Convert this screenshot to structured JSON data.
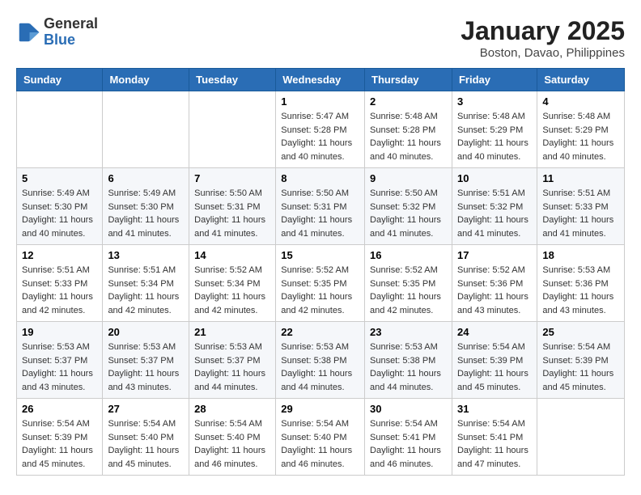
{
  "header": {
    "logo_line1": "General",
    "logo_line2": "Blue",
    "title": "January 2025",
    "subtitle": "Boston, Davao, Philippines"
  },
  "calendar": {
    "days_of_week": [
      "Sunday",
      "Monday",
      "Tuesday",
      "Wednesday",
      "Thursday",
      "Friday",
      "Saturday"
    ],
    "weeks": [
      [
        {
          "day": "",
          "info": ""
        },
        {
          "day": "",
          "info": ""
        },
        {
          "day": "",
          "info": ""
        },
        {
          "day": "1",
          "info": "Sunrise: 5:47 AM\nSunset: 5:28 PM\nDaylight: 11 hours\nand 40 minutes."
        },
        {
          "day": "2",
          "info": "Sunrise: 5:48 AM\nSunset: 5:28 PM\nDaylight: 11 hours\nand 40 minutes."
        },
        {
          "day": "3",
          "info": "Sunrise: 5:48 AM\nSunset: 5:29 PM\nDaylight: 11 hours\nand 40 minutes."
        },
        {
          "day": "4",
          "info": "Sunrise: 5:48 AM\nSunset: 5:29 PM\nDaylight: 11 hours\nand 40 minutes."
        }
      ],
      [
        {
          "day": "5",
          "info": "Sunrise: 5:49 AM\nSunset: 5:30 PM\nDaylight: 11 hours\nand 40 minutes."
        },
        {
          "day": "6",
          "info": "Sunrise: 5:49 AM\nSunset: 5:30 PM\nDaylight: 11 hours\nand 41 minutes."
        },
        {
          "day": "7",
          "info": "Sunrise: 5:50 AM\nSunset: 5:31 PM\nDaylight: 11 hours\nand 41 minutes."
        },
        {
          "day": "8",
          "info": "Sunrise: 5:50 AM\nSunset: 5:31 PM\nDaylight: 11 hours\nand 41 minutes."
        },
        {
          "day": "9",
          "info": "Sunrise: 5:50 AM\nSunset: 5:32 PM\nDaylight: 11 hours\nand 41 minutes."
        },
        {
          "day": "10",
          "info": "Sunrise: 5:51 AM\nSunset: 5:32 PM\nDaylight: 11 hours\nand 41 minutes."
        },
        {
          "day": "11",
          "info": "Sunrise: 5:51 AM\nSunset: 5:33 PM\nDaylight: 11 hours\nand 41 minutes."
        }
      ],
      [
        {
          "day": "12",
          "info": "Sunrise: 5:51 AM\nSunset: 5:33 PM\nDaylight: 11 hours\nand 42 minutes."
        },
        {
          "day": "13",
          "info": "Sunrise: 5:51 AM\nSunset: 5:34 PM\nDaylight: 11 hours\nand 42 minutes."
        },
        {
          "day": "14",
          "info": "Sunrise: 5:52 AM\nSunset: 5:34 PM\nDaylight: 11 hours\nand 42 minutes."
        },
        {
          "day": "15",
          "info": "Sunrise: 5:52 AM\nSunset: 5:35 PM\nDaylight: 11 hours\nand 42 minutes."
        },
        {
          "day": "16",
          "info": "Sunrise: 5:52 AM\nSunset: 5:35 PM\nDaylight: 11 hours\nand 42 minutes."
        },
        {
          "day": "17",
          "info": "Sunrise: 5:52 AM\nSunset: 5:36 PM\nDaylight: 11 hours\nand 43 minutes."
        },
        {
          "day": "18",
          "info": "Sunrise: 5:53 AM\nSunset: 5:36 PM\nDaylight: 11 hours\nand 43 minutes."
        }
      ],
      [
        {
          "day": "19",
          "info": "Sunrise: 5:53 AM\nSunset: 5:37 PM\nDaylight: 11 hours\nand 43 minutes."
        },
        {
          "day": "20",
          "info": "Sunrise: 5:53 AM\nSunset: 5:37 PM\nDaylight: 11 hours\nand 43 minutes."
        },
        {
          "day": "21",
          "info": "Sunrise: 5:53 AM\nSunset: 5:37 PM\nDaylight: 11 hours\nand 44 minutes."
        },
        {
          "day": "22",
          "info": "Sunrise: 5:53 AM\nSunset: 5:38 PM\nDaylight: 11 hours\nand 44 minutes."
        },
        {
          "day": "23",
          "info": "Sunrise: 5:53 AM\nSunset: 5:38 PM\nDaylight: 11 hours\nand 44 minutes."
        },
        {
          "day": "24",
          "info": "Sunrise: 5:54 AM\nSunset: 5:39 PM\nDaylight: 11 hours\nand 45 minutes."
        },
        {
          "day": "25",
          "info": "Sunrise: 5:54 AM\nSunset: 5:39 PM\nDaylight: 11 hours\nand 45 minutes."
        }
      ],
      [
        {
          "day": "26",
          "info": "Sunrise: 5:54 AM\nSunset: 5:39 PM\nDaylight: 11 hours\nand 45 minutes."
        },
        {
          "day": "27",
          "info": "Sunrise: 5:54 AM\nSunset: 5:40 PM\nDaylight: 11 hours\nand 45 minutes."
        },
        {
          "day": "28",
          "info": "Sunrise: 5:54 AM\nSunset: 5:40 PM\nDaylight: 11 hours\nand 46 minutes."
        },
        {
          "day": "29",
          "info": "Sunrise: 5:54 AM\nSunset: 5:40 PM\nDaylight: 11 hours\nand 46 minutes."
        },
        {
          "day": "30",
          "info": "Sunrise: 5:54 AM\nSunset: 5:41 PM\nDaylight: 11 hours\nand 46 minutes."
        },
        {
          "day": "31",
          "info": "Sunrise: 5:54 AM\nSunset: 5:41 PM\nDaylight: 11 hours\nand 47 minutes."
        },
        {
          "day": "",
          "info": ""
        }
      ]
    ]
  }
}
